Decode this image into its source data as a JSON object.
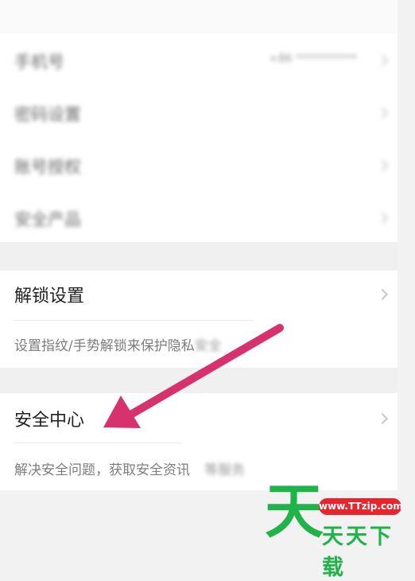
{
  "settings": {
    "rows": [
      {
        "label": "手机号",
        "value": "+86 ***********"
      },
      {
        "label": "密码设置",
        "value": ""
      },
      {
        "label": "账号授权",
        "value": ""
      },
      {
        "label": "安全产品",
        "value": ""
      }
    ]
  },
  "unlock": {
    "title": "解锁设置",
    "desc_visible": "设置指纹/手势解锁来保护隐私",
    "desc_faded": "安全"
  },
  "security": {
    "title": "安全中心",
    "desc_visible": "解决安全问题，获取安全资讯",
    "desc_faded": "等服务"
  },
  "watermark": {
    "big_char": "天",
    "url": "www.TTzip.com",
    "text": "天天下载"
  },
  "colors": {
    "arrow": "#d8326e",
    "watermark_green": "#1fb34a",
    "watermark_red": "#e8242d"
  }
}
